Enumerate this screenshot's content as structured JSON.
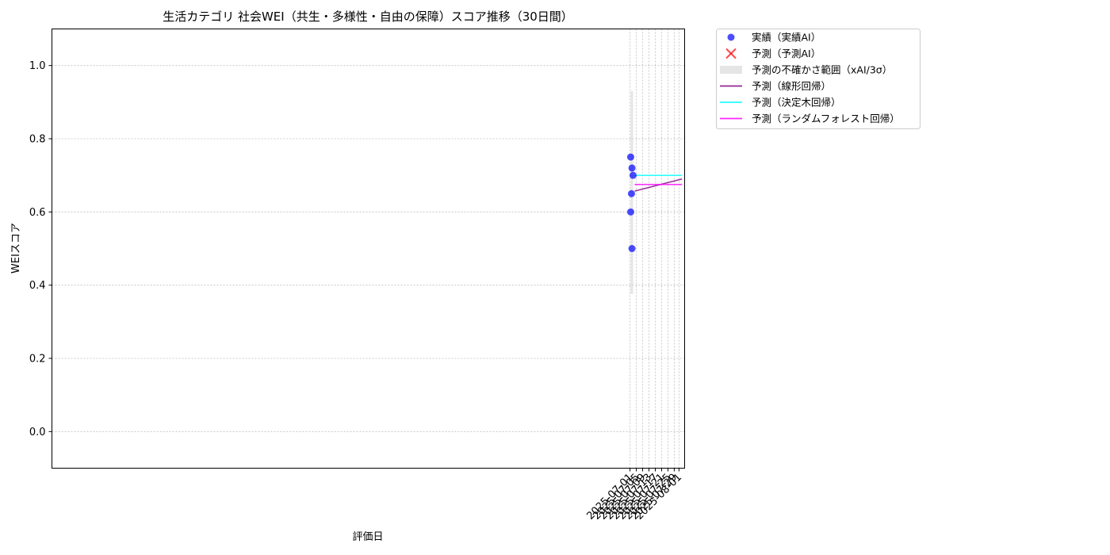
{
  "chart_data": {
    "type": "scatter",
    "title": "生活カテゴリ 社会WEI（共生・多様性・自由の保障）スコア推移（30日間）",
    "xlabel": "評価日",
    "ylabel": "WEIスコア",
    "xlim": [
      "2024-06-29T22:00",
      "2025-08-04T14:00"
    ],
    "ylim": [
      -0.1,
      1.1
    ],
    "xticks": [
      "2025-07-01",
      "2025-07-05",
      "2025-07-09",
      "2025-07-13",
      "2025-07-17",
      "2025-07-21",
      "2025-07-25",
      "2025-07-29",
      "2025-08-01"
    ],
    "yticks": [
      0.0,
      0.2,
      0.4,
      0.6,
      0.8,
      1.0
    ],
    "ytick_labels": [
      "0.0",
      "0.2",
      "0.4",
      "0.6",
      "0.8",
      "1.0"
    ],
    "grid": true,
    "legend_position": "outside-right-top",
    "series": [
      {
        "name": "実績（実績AI）",
        "kind": "scatter",
        "color": "#0000ff",
        "points": [
          {
            "x": "2025-07-01T10:00",
            "y": 0.75
          },
          {
            "x": "2025-07-01T10:00",
            "y": 0.6
          },
          {
            "x": "2025-07-01T22:00",
            "y": 0.65
          },
          {
            "x": "2025-07-02T06:00",
            "y": 0.72
          },
          {
            "x": "2025-07-02T06:00",
            "y": 0.5
          },
          {
            "x": "2025-07-02T22:00",
            "y": 0.7
          }
        ]
      },
      {
        "name": "予測（予測AI）",
        "kind": "scatter-x",
        "color": "#ff0000",
        "points": []
      },
      {
        "name": "予測の不確かさ範囲（xAI/3σ）",
        "kind": "band",
        "color": "#d3d3d3",
        "x_range": [
          "2025-07-01T10:00",
          "2025-07-02T22:00"
        ],
        "y_range": [
          0.376,
          0.93
        ]
      },
      {
        "name": "予測（線形回帰）",
        "kind": "line",
        "color": "#800080",
        "points": [
          {
            "x": "2025-07-03T22:00",
            "y": 0.657
          },
          {
            "x": "2025-08-02T22:00",
            "y": 0.69
          }
        ]
      },
      {
        "name": "予測（決定木回帰）",
        "kind": "line",
        "color": "#00ffff",
        "points": [
          {
            "x": "2025-07-03T22:00",
            "y": 0.7
          },
          {
            "x": "2025-08-02T22:00",
            "y": 0.7
          }
        ]
      },
      {
        "name": "予測（ランダムフォレスト回帰）",
        "kind": "line",
        "color": "#ff00ff",
        "points": [
          {
            "x": "2025-07-03T22:00",
            "y": 0.675
          },
          {
            "x": "2025-08-02T22:00",
            "y": 0.675
          }
        ]
      }
    ]
  }
}
